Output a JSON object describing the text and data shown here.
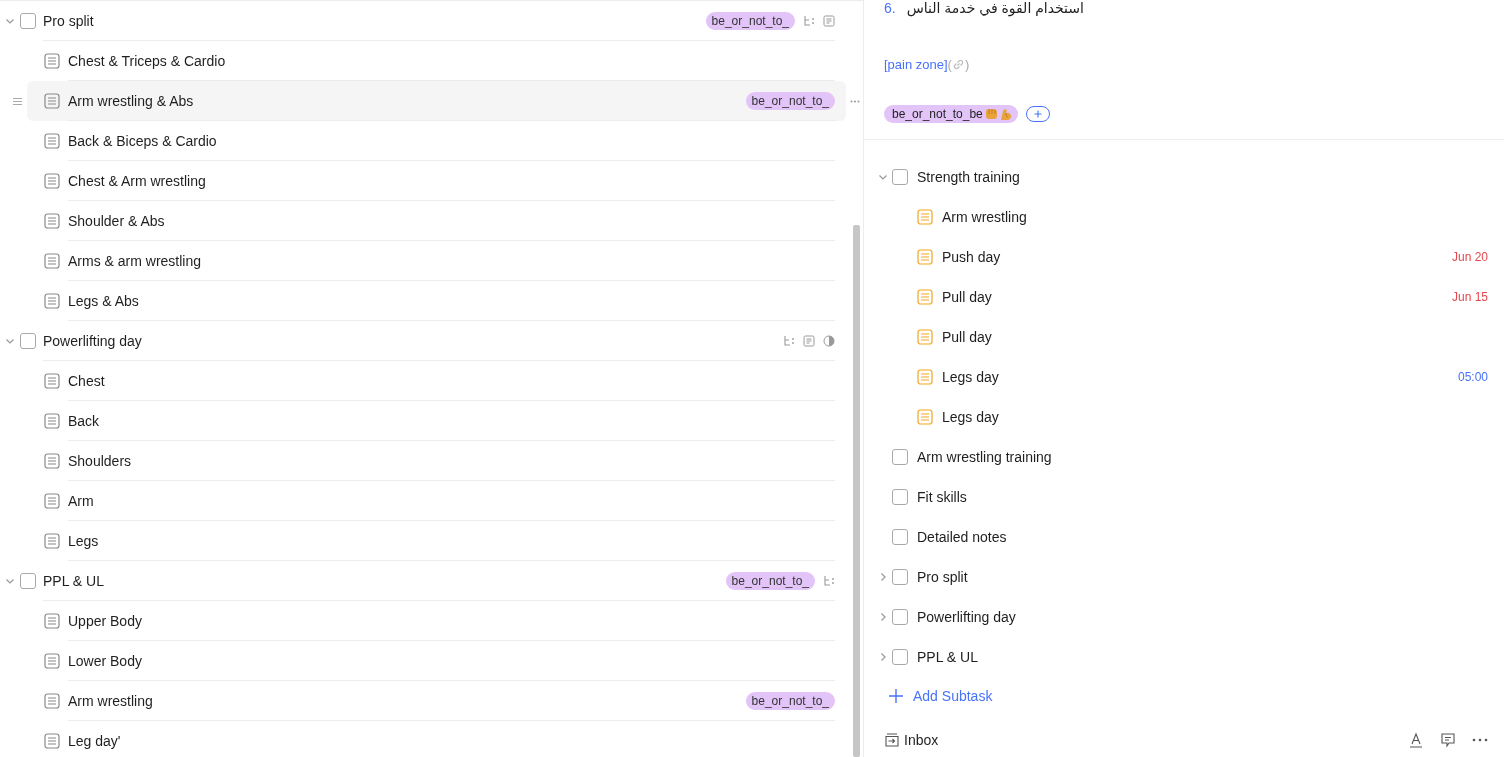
{
  "task_list": {
    "groups": [
      {
        "title": "Pro split",
        "checked": false,
        "expanded": true,
        "tags": [
          "be_or_not_to_"
        ],
        "indicators": [
          {
            "kind": "subtasks"
          },
          {
            "kind": "note"
          }
        ],
        "children": [
          {
            "title": "Chest & Triceps & Cardio",
            "hovered": false
          },
          {
            "title": "Arm wrestling & Abs",
            "hovered": true,
            "tags": [
              "be_or_not_to_"
            ]
          },
          {
            "title": "Back & Biceps & Cardio",
            "hovered": false
          },
          {
            "title": "Chest & Arm wrestling",
            "hovered": false
          },
          {
            "title": "Shoulder & Abs",
            "hovered": false
          },
          {
            "title": "Arms & arm wrestling",
            "hovered": false
          },
          {
            "title": "Legs & Abs",
            "hovered": false
          }
        ]
      },
      {
        "title": "Powerlifting day",
        "checked": false,
        "expanded": true,
        "indicators": [
          {
            "kind": "subtasks"
          },
          {
            "kind": "note"
          },
          {
            "kind": "progress"
          }
        ],
        "children": [
          {
            "title": "Chest",
            "hovered": false
          },
          {
            "title": "Back",
            "hovered": false
          },
          {
            "title": "Shoulders",
            "hovered": false
          },
          {
            "title": "Arm",
            "hovered": false
          },
          {
            "title": "Legs",
            "hovered": false
          }
        ]
      },
      {
        "title": "PPL & UL",
        "checked": false,
        "expanded": true,
        "tags": [
          "be_or_not_to_"
        ],
        "indicators": [
          {
            "kind": "subtasks"
          }
        ],
        "children": [
          {
            "title": "Upper Body",
            "hovered": false
          },
          {
            "title": "Lower Body",
            "hovered": false
          },
          {
            "title": "Arm wrestling",
            "hovered": false,
            "tags": [
              "be_or_not_to_"
            ]
          },
          {
            "title": "Leg day'",
            "hovered": false
          }
        ]
      }
    ]
  },
  "detail": {
    "description": {
      "number": "6.",
      "text": "استخدام القوة في خدمة الناس"
    },
    "link": {
      "text": "[pain zone]",
      "open": "(",
      "close": ")"
    },
    "tags": [
      "be_or_not_to_be"
    ],
    "subtasks": [
      {
        "title": "Strength training",
        "checked": false,
        "expanded": true,
        "children": [
          {
            "title": "Arm wrestling"
          },
          {
            "title": "Push day",
            "due": {
              "text": "Jun 20",
              "color": "#e5484d"
            }
          },
          {
            "title": "Pull day",
            "due": {
              "text": "Jun 15",
              "color": "#e5484d"
            }
          },
          {
            "title": "Pull day"
          },
          {
            "title": "Legs day",
            "due": {
              "text": "05:00",
              "color": "#4772fa"
            }
          },
          {
            "title": "Legs day"
          }
        ]
      },
      {
        "title": "Arm wrestling training",
        "checked": false
      },
      {
        "title": "Fit skills",
        "checked": false
      },
      {
        "title": "Detailed notes",
        "checked": false
      },
      {
        "title": "Pro split",
        "checked": false,
        "expanded": false
      },
      {
        "title": "Powerlifting day",
        "checked": false,
        "expanded": false
      },
      {
        "title": "PPL & UL",
        "checked": false,
        "expanded": false
      }
    ],
    "add_subtask": {
      "label": "Add Subtask"
    },
    "footer": {
      "list": "Inbox"
    }
  }
}
